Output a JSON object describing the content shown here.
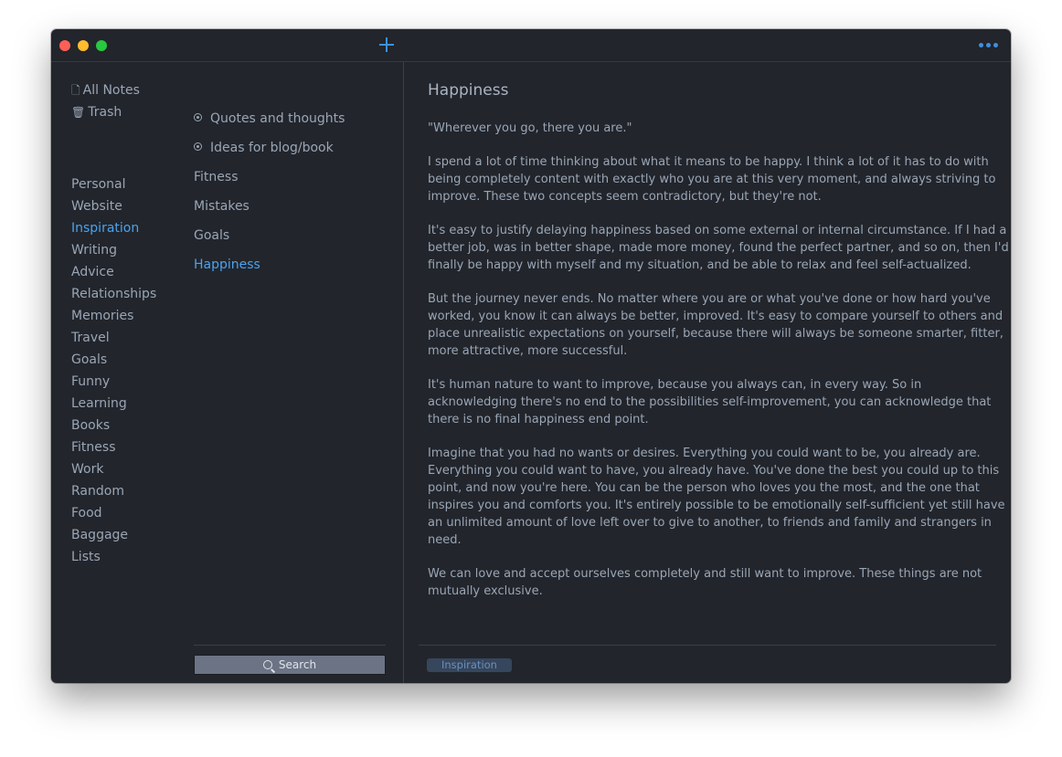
{
  "sidebar": {
    "system_items": [
      {
        "label": "All Notes",
        "icon": "note-icon"
      },
      {
        "label": "Trash",
        "icon": "trash-icon"
      }
    ],
    "tags": [
      "Personal",
      "Website",
      "Inspiration",
      "Writing",
      "Advice",
      "Relationships",
      "Memories",
      "Travel",
      "Goals",
      "Funny",
      "Learning",
      "Books",
      "Fitness",
      "Work",
      "Random",
      "Food",
      "Baggage",
      "Lists"
    ],
    "active_tag": "Inspiration"
  },
  "notes": {
    "items": [
      {
        "label": "Quotes and thoughts",
        "pinned": true
      },
      {
        "label": "Ideas for blog/book",
        "pinned": true
      },
      {
        "label": "Fitness",
        "pinned": false
      },
      {
        "label": "Mistakes",
        "pinned": false
      },
      {
        "label": "Goals",
        "pinned": false
      },
      {
        "label": "Happiness",
        "pinned": false
      }
    ],
    "active_note": "Happiness",
    "search_label": "Search"
  },
  "editor": {
    "title": "Happiness",
    "paragraphs": [
      "\"Wherever you go, there you are.\"",
      "I spend a lot of time thinking about what it means to be happy. I think a lot of it has to do with being completely content with exactly who you are at this very moment, and always striving to improve. These two concepts seem contradictory, but they're not.",
      "It's easy to justify delaying happiness based on some external or internal circumstance. If I had a better job, was in better shape, made more money, found the perfect partner, and so on, then I'd finally be happy with myself and my situation, and be able to relax and feel self-actualized.",
      "But the journey never ends. No matter where you are or what you've done or how hard you've worked, you know it can always be better, improved. It's easy to compare yourself to others and place unrealistic expectations on yourself, because there will always be someone smarter, fitter, more attractive, more successful.",
      "It's human nature to want to improve, because you always can, in every way. So in acknowledging there's no end to the possibilities self-improvement, you can acknowledge that there is no final happiness end point.",
      "Imagine that you had no wants or desires. Everything you could want to be, you already are. Everything you could want to have, you already have. You've done the best you could up to this point, and now you're here. You can be the person who loves you the most, and the one that inspires you and comforts you. It's entirely possible to be emotionally self-sufficient yet still have an unlimited amount of love left over to give to another, to friends and family and strangers in need.",
      "We can love and accept ourselves completely and still want to improve. These things are not mutually exclusive."
    ],
    "tag": "Inspiration"
  },
  "colors": {
    "background": "#22252b",
    "text": "#9aa6b6",
    "accent": "#4aa3f0",
    "tag_pill": "#36465c"
  }
}
